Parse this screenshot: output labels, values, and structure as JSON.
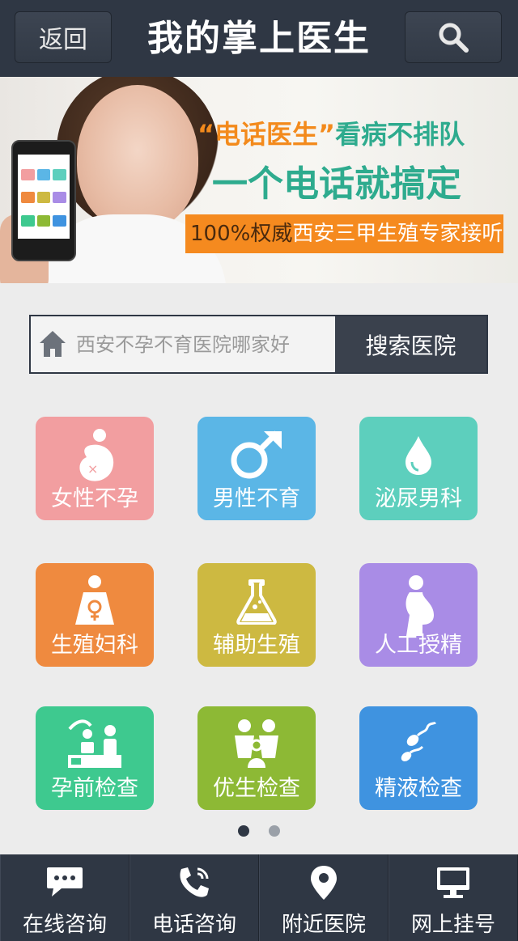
{
  "header": {
    "back_label": "返回",
    "title": "我的掌上医生",
    "search_icon": "search-icon"
  },
  "banner": {
    "quote_open": "“",
    "phone_doctor": "电话医生",
    "quote_close": "”",
    "no_queue": "看病不排队",
    "line2": "一个电话就搞定",
    "tag_percent": "100%权威",
    "tag_rest": "西安三甲生殖专家接听"
  },
  "search": {
    "placeholder": "西安不孕不育医院哪家好",
    "button_label": "搜索医院",
    "icon": "home-icon"
  },
  "tiles": [
    {
      "label": "女性不孕",
      "icon": "pregnant-female-icon",
      "color": "#f29ea0"
    },
    {
      "label": "男性不育",
      "icon": "male-symbol-icon",
      "color": "#5bb6e6"
    },
    {
      "label": "泌尿男科",
      "icon": "droplet-icon",
      "color": "#5dcfbd"
    },
    {
      "label": "生殖妇科",
      "icon": "woman-female-symbol-icon",
      "color": "#ef8a3f"
    },
    {
      "label": "辅助生殖",
      "icon": "flask-icon",
      "color": "#cdb941"
    },
    {
      "label": "人工授精",
      "icon": "pregnant-silhouette-icon",
      "color": "#a98ce6"
    },
    {
      "label": "孕前检查",
      "icon": "doctor-exam-icon",
      "color": "#3ec98f"
    },
    {
      "label": "优生检查",
      "icon": "family-icon",
      "color": "#8db935"
    },
    {
      "label": "精液检查",
      "icon": "sperm-icon",
      "color": "#3f93e0"
    }
  ],
  "pager": {
    "active": 1,
    "total": 2,
    "active_color": "#2f3744",
    "inactive_color": "#9aa0a8"
  },
  "bottom_nav": [
    {
      "label": "在线咨询",
      "icon": "chat-bubble-icon"
    },
    {
      "label": "电话咨询",
      "icon": "phone-icon"
    },
    {
      "label": "附近医院",
      "icon": "location-pin-icon"
    },
    {
      "label": "网上挂号",
      "icon": "monitor-icon"
    }
  ]
}
